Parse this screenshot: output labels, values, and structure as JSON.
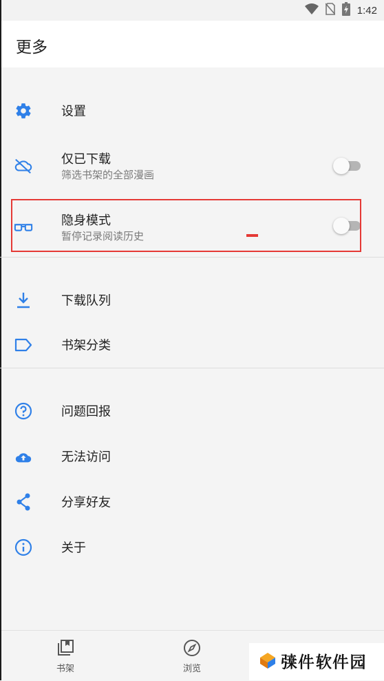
{
  "status_bar": {
    "time": "1:42"
  },
  "toolbar": {
    "title": "更多"
  },
  "sections": {
    "items": [
      {
        "title": "设置"
      },
      {
        "title": "仅已下载",
        "subtitle": "筛选书架的全部漫画"
      },
      {
        "title": "隐身模式",
        "subtitle": "暂停记录阅读历史"
      },
      {
        "title": "下载队列"
      },
      {
        "title": "书架分类"
      },
      {
        "title": "问题回报"
      },
      {
        "title": "无法访问"
      },
      {
        "title": "分享好友"
      },
      {
        "title": "关于"
      }
    ]
  },
  "toggles": {
    "downloaded_only": false,
    "incognito": false
  },
  "bottom_nav": {
    "library": "书架",
    "browse": "浏览"
  },
  "watermark": {
    "text": "𢐇件软件园"
  },
  "colors": {
    "accent": "#2f80e8",
    "highlight": "#e53935",
    "toggle_off": "#b5b5b5"
  }
}
